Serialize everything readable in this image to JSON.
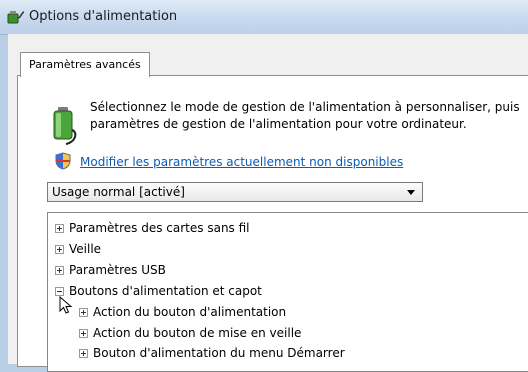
{
  "window": {
    "title": "Options d'alimentation",
    "icon": "power-options-icon"
  },
  "tabs": [
    {
      "label": "Paramètres avancés",
      "selected": true
    }
  ],
  "description": {
    "line1": "Sélectionnez le mode de gestion de l'alimentation à personnaliser, puis",
    "line2": "paramètres de gestion de l'alimentation pour votre ordinateur.",
    "icon": "battery-icon"
  },
  "link": {
    "label": "Modifier les paramètres actuellement non disponibles",
    "icon": "shield-icon"
  },
  "plan_select": {
    "value": "Usage normal [activé]"
  },
  "tree": {
    "items": [
      {
        "label": "Paramètres des cartes sans fil",
        "expanded": false,
        "level": 0
      },
      {
        "label": "Veille",
        "expanded": false,
        "level": 0
      },
      {
        "label": "Paramètres USB",
        "expanded": false,
        "level": 0
      },
      {
        "label": "Boutons d'alimentation et capot",
        "expanded": true,
        "level": 0
      },
      {
        "label": "Action du bouton d'alimentation",
        "expanded": false,
        "level": 1
      },
      {
        "label": "Action du bouton de mise en veille",
        "expanded": false,
        "level": 1
      },
      {
        "label": "Bouton d'alimentation du menu Démarrer",
        "expanded": false,
        "level": 1
      }
    ]
  },
  "colors": {
    "link": "#0b5cb5",
    "titlebar": "#c7d9ee"
  }
}
